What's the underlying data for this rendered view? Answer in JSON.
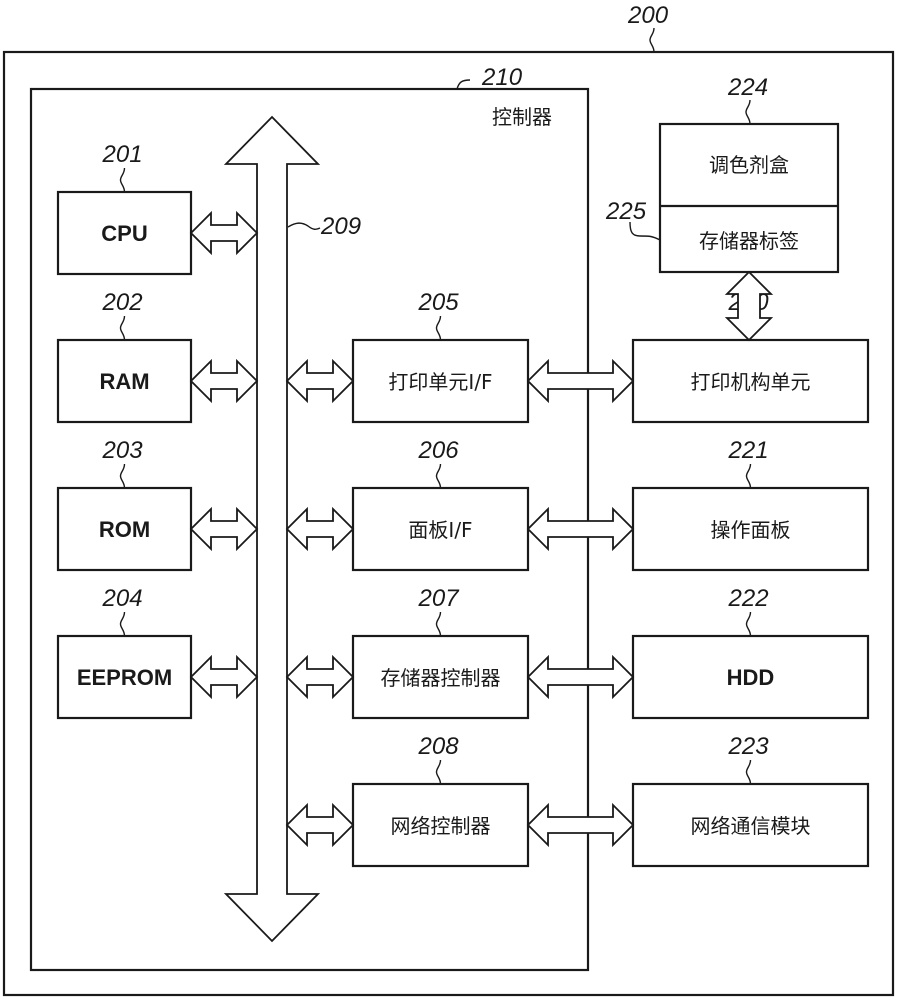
{
  "diagram": {
    "type": "block-diagram",
    "apparatus": {
      "ref": "200"
    },
    "controller": {
      "ref": "210",
      "title": "控制器"
    },
    "bus": {
      "ref": "209"
    },
    "left_blocks": [
      {
        "ref": "201",
        "label": "CPU"
      },
      {
        "ref": "202",
        "label": "RAM"
      },
      {
        "ref": "203",
        "label": "ROM"
      },
      {
        "ref": "204",
        "label": "EEPROM"
      }
    ],
    "interface_blocks": [
      {
        "ref": "205",
        "label": "打印单元I/F"
      },
      {
        "ref": "206",
        "label": "面板I/F"
      },
      {
        "ref": "207",
        "label": "存储器控制器"
      },
      {
        "ref": "208",
        "label": "网络控制器"
      }
    ],
    "external_blocks": [
      {
        "ref": "220",
        "label": "打印机构单元"
      },
      {
        "ref": "221",
        "label": "操作面板"
      },
      {
        "ref": "222",
        "label": "HDD"
      },
      {
        "ref": "223",
        "label": "网络通信模块"
      }
    ],
    "cartridge": {
      "ref": "224",
      "label": "调色剂盒",
      "memory_tag": {
        "ref": "225",
        "label": "存储器标签"
      }
    }
  }
}
